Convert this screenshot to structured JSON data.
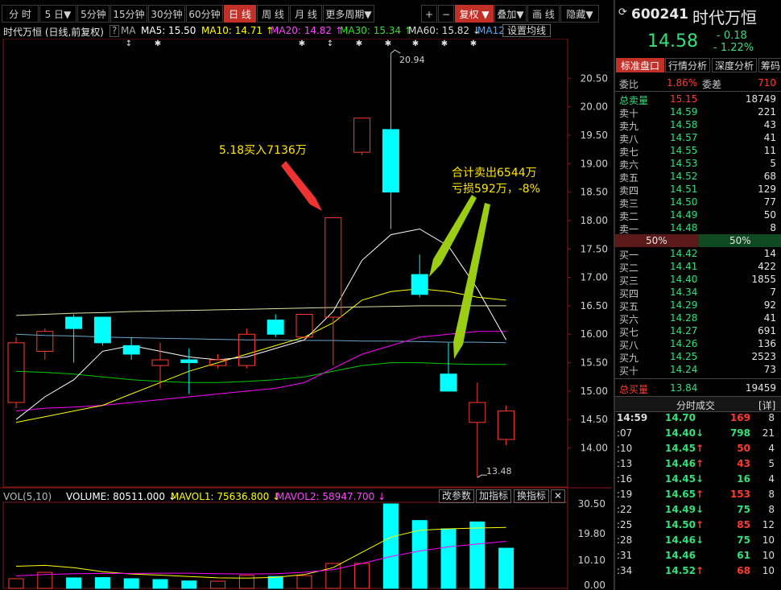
{
  "toolbar": {
    "periods": [
      "分 时",
      "5 日▼",
      "5分钟",
      "15分钟",
      "30分钟",
      "60分钟",
      "日 线",
      "周 线",
      "月 线",
      "更多周期▼"
    ],
    "active_period": "日 线",
    "controls": [
      "+",
      "−",
      "复权 ▼",
      "叠加▼",
      "画 线",
      "隐藏▼"
    ],
    "active_control": "复权 ▼"
  },
  "chart_header": {
    "name": "时代万恒 (日线,前复权)",
    "help": "?",
    "ma_label": "MA",
    "ma5": "MA5: 15.50",
    "ma10": "MA10: 14.71 ↑",
    "ma20": "MA20: 14.82 ↑",
    "ma30": "MA30: 15.34 ↑",
    "ma60": "MA60: 15.82 ↓",
    "ma120": "MA12",
    "settings": "设置均线"
  },
  "annotations": {
    "buy": "5.18买入7136万",
    "sell_line1": "合计卖出6544万",
    "sell_line2": "亏损592万，-8%",
    "high_label": "20.94",
    "low_label": "13.48"
  },
  "volume_header": {
    "vol": "VOL(5,10)",
    "volume": "VOLUME: 80511.000 ↓",
    "mavol1": "MAVOL1: 75636.800 ↓",
    "mavol2": "MAVOL2: 58947.700 ↓",
    "btn1": "改参数",
    "btn2": "加指标",
    "btn3": "换指标",
    "close": "✕"
  },
  "colors": {
    "up": "#ff3b30",
    "down": "#00ffff",
    "ma5": "#ffffff",
    "ma10": "#ffff00",
    "ma20": "#ff00ff",
    "ma30": "#00cc00",
    "ma60": "#e0e0a0",
    "accent": "#c23127"
  },
  "chart_data": {
    "type": "candlestick",
    "price_axis": {
      "ticks": [
        20.5,
        20.0,
        19.5,
        19.0,
        18.5,
        18.0,
        17.5,
        17.0,
        16.5,
        16.0,
        15.5,
        15.0,
        14.5,
        14.0
      ],
      "range": [
        13.3,
        21.0
      ]
    },
    "candles": [
      {
        "o": 14.8,
        "h": 15.95,
        "l": 14.7,
        "c": 15.85,
        "dir": "up"
      },
      {
        "o": 15.7,
        "h": 16.1,
        "l": 15.55,
        "c": 16.05,
        "dir": "up"
      },
      {
        "o": 16.3,
        "h": 16.35,
        "l": 15.5,
        "c": 16.1,
        "dir": "down"
      },
      {
        "o": 16.3,
        "h": 16.25,
        "l": 15.8,
        "c": 15.85,
        "dir": "down"
      },
      {
        "o": 15.8,
        "h": 15.95,
        "l": 15.55,
        "c": 15.65,
        "dir": "down"
      },
      {
        "o": 15.55,
        "h": 15.85,
        "l": 15.05,
        "c": 15.45,
        "dir": "up"
      },
      {
        "o": 15.55,
        "h": 15.75,
        "l": 14.95,
        "c": 15.5,
        "dir": "down"
      },
      {
        "o": 15.45,
        "h": 15.65,
        "l": 15.4,
        "c": 15.55,
        "dir": "up"
      },
      {
        "o": 15.45,
        "h": 16.1,
        "l": 15.4,
        "c": 16.0,
        "dir": "up"
      },
      {
        "o": 16.0,
        "h": 16.35,
        "l": 15.95,
        "c": 16.25,
        "dir": "down"
      },
      {
        "o": 15.95,
        "h": 16.35,
        "l": 15.9,
        "c": 16.35,
        "dir": "up"
      },
      {
        "o": 16.3,
        "h": 18.05,
        "l": 15.45,
        "c": 18.05,
        "dir": "up"
      },
      {
        "o": 19.2,
        "h": 19.8,
        "l": 19.15,
        "c": 19.8,
        "dir": "up"
      },
      {
        "o": 19.6,
        "h": 20.94,
        "l": 17.85,
        "c": 18.5,
        "dir": "down"
      },
      {
        "o": 17.05,
        "h": 17.4,
        "l": 16.65,
        "c": 16.7,
        "dir": "down"
      },
      {
        "o": 15.3,
        "h": 15.85,
        "l": 15.0,
        "c": 15.0,
        "dir": "down"
      },
      {
        "o": 14.45,
        "h": 15.15,
        "l": 13.48,
        "c": 14.8,
        "dir": "up"
      },
      {
        "o": 14.15,
        "h": 14.75,
        "l": 14.05,
        "c": 14.65,
        "dir": "up"
      }
    ],
    "volume_axis": {
      "ticks": [
        30.5,
        19.8,
        10.1,
        0.0
      ],
      "range": [
        0,
        30.5
      ]
    },
    "volumes": [
      {
        "v": 3.5,
        "dir": "up"
      },
      {
        "v": 5.8,
        "dir": "up"
      },
      {
        "v": 3.8,
        "dir": "down"
      },
      {
        "v": 3.9,
        "dir": "down"
      },
      {
        "v": 3.5,
        "dir": "down"
      },
      {
        "v": 3.2,
        "dir": "down"
      },
      {
        "v": 2.7,
        "dir": "down"
      },
      {
        "v": 2.6,
        "dir": "up"
      },
      {
        "v": 4.7,
        "dir": "up"
      },
      {
        "v": 4.3,
        "dir": "down"
      },
      {
        "v": 4.6,
        "dir": "up"
      },
      {
        "v": 9.0,
        "dir": "up"
      },
      {
        "v": 9.0,
        "dir": "up"
      },
      {
        "v": 30.5,
        "dir": "down"
      },
      {
        "v": 24.5,
        "dir": "down"
      },
      {
        "v": 21.5,
        "dir": "down"
      },
      {
        "v": 24.0,
        "dir": "down"
      },
      {
        "v": 14.5,
        "dir": "down"
      }
    ],
    "ma5": [
      14.5,
      14.9,
      15.2,
      15.7,
      15.8,
      15.7,
      15.6,
      15.55,
      15.6,
      15.75,
      15.9,
      16.4,
      17.3,
      17.75,
      17.85,
      17.55,
      16.8,
      15.9
    ],
    "ma10": [
      14.45,
      14.55,
      14.65,
      14.75,
      14.95,
      15.15,
      15.35,
      15.5,
      15.65,
      15.8,
      15.95,
      16.2,
      16.6,
      16.75,
      16.8,
      16.75,
      16.65,
      16.6
    ],
    "ma20": [
      14.65,
      14.7,
      14.72,
      14.75,
      14.8,
      14.85,
      14.9,
      14.95,
      15.0,
      15.05,
      15.15,
      15.4,
      15.65,
      15.8,
      15.95,
      16.0,
      16.05,
      16.05
    ],
    "ma30": [
      15.35,
      15.33,
      15.3,
      15.25,
      15.2,
      15.17,
      15.15,
      15.15,
      15.17,
      15.2,
      15.25,
      15.35,
      15.45,
      15.5,
      15.5,
      15.48,
      15.47,
      15.47
    ],
    "ma60": [
      16.33,
      16.35,
      16.37,
      16.38,
      16.4,
      16.41,
      16.42,
      16.43,
      16.44,
      16.45,
      16.46,
      16.47,
      16.48,
      16.49,
      16.5,
      16.5,
      16.5,
      16.5
    ],
    "maflat": [
      16.0,
      15.98,
      15.97,
      15.95,
      15.94,
      15.93,
      15.92,
      15.91,
      15.9,
      15.9,
      15.89,
      15.89,
      15.88,
      15.88,
      15.87,
      15.86,
      15.86,
      15.85
    ],
    "mavol1": [
      8.0,
      8.3,
      7.5,
      6.0,
      5.2,
      4.8,
      4.3,
      3.8,
      3.7,
      4.0,
      5.0,
      7.5,
      13.0,
      18.5,
      21.0,
      21.5,
      21.8,
      22.0
    ],
    "mavol2": [
      4.5,
      5.0,
      5.3,
      5.4,
      5.4,
      5.5,
      5.5,
      5.3,
      5.2,
      5.3,
      5.8,
      6.8,
      9.0,
      11.5,
      13.5,
      15.0,
      16.0,
      17.0
    ]
  },
  "quote": {
    "code": "600241",
    "name": "时代万恒",
    "price": "14.58",
    "change": "- 0.18",
    "change_pct": "- 1.22%",
    "tabs": [
      "标准盘口",
      "行情分析",
      "深度分析",
      "筹码"
    ],
    "webi_label": "委比",
    "webi_value": "1.86%",
    "weicha_label": "委差",
    "weicha_value": "710",
    "total_sell_label": "总卖量",
    "total_sell_price": "15.15",
    "total_sell_vol": "18749",
    "sells": [
      {
        "label": "卖十",
        "price": "14.59",
        "vol": "221"
      },
      {
        "label": "卖九",
        "price": "14.58",
        "vol": "43"
      },
      {
        "label": "卖八",
        "price": "14.57",
        "vol": "41"
      },
      {
        "label": "卖七",
        "price": "14.55",
        "vol": "11"
      },
      {
        "label": "卖六",
        "price": "14.53",
        "vol": "5"
      },
      {
        "label": "卖五",
        "price": "14.52",
        "vol": "68"
      },
      {
        "label": "卖四",
        "price": "14.51",
        "vol": "129"
      },
      {
        "label": "卖三",
        "price": "14.50",
        "vol": "77"
      },
      {
        "label": "卖二",
        "price": "14.49",
        "vol": "50"
      },
      {
        "label": "卖一",
        "price": "14.48",
        "vol": "8"
      }
    ],
    "ratio_left": "50%",
    "ratio_right": "50%",
    "ratio_left_share": 0.5,
    "buys": [
      {
        "label": "买一",
        "price": "14.42",
        "vol": "14"
      },
      {
        "label": "买二",
        "price": "14.41",
        "vol": "422"
      },
      {
        "label": "买三",
        "price": "14.40",
        "vol": "1855"
      },
      {
        "label": "买四",
        "price": "14.34",
        "vol": "7"
      },
      {
        "label": "买五",
        "price": "14.29",
        "vol": "92"
      },
      {
        "label": "买六",
        "price": "14.28",
        "vol": "41"
      },
      {
        "label": "买七",
        "price": "14.27",
        "vol": "691"
      },
      {
        "label": "买八",
        "price": "14.26",
        "vol": "136"
      },
      {
        "label": "买九",
        "price": "14.25",
        "vol": "2523"
      },
      {
        "label": "买十",
        "price": "14.24",
        "vol": "73"
      }
    ],
    "total_buy_label": "总买量",
    "total_buy_price": "13.84",
    "total_buy_vol": "19459",
    "ticks_title": "分时成交",
    "ticks_detail": "[详]",
    "ticks": [
      {
        "t": "14:59",
        "p": "14.70",
        "a": "",
        "v": "169",
        "n": "8",
        "c": "up"
      },
      {
        "t": ":07",
        "p": "14.40",
        "a": "↓",
        "v": "798",
        "n": "21",
        "c": "down"
      },
      {
        "t": ":10",
        "p": "14.45",
        "a": "↑",
        "v": "50",
        "n": "4",
        "c": "up"
      },
      {
        "t": ":13",
        "p": "14.46",
        "a": "↑",
        "v": "43",
        "n": "5",
        "c": "up"
      },
      {
        "t": ":16",
        "p": "14.45",
        "a": "↓",
        "v": "16",
        "n": "4",
        "c": "down"
      },
      {
        "t": ":19",
        "p": "14.65",
        "a": "↑",
        "v": "153",
        "n": "8",
        "c": "up"
      },
      {
        "t": ":22",
        "p": "14.49",
        "a": "↓",
        "v": "75",
        "n": "8",
        "c": "down"
      },
      {
        "t": ":25",
        "p": "14.50",
        "a": "↑",
        "v": "85",
        "n": "12",
        "c": "up"
      },
      {
        "t": ":28",
        "p": "14.46",
        "a": "↓",
        "v": "75",
        "n": "10",
        "c": "down"
      },
      {
        "t": ":31",
        "p": "14.46",
        "a": "",
        "v": "61",
        "n": "10",
        "c": "down"
      },
      {
        "t": ":34",
        "p": "14.52",
        "a": "↑",
        "v": "68",
        "n": "10",
        "c": "up"
      }
    ]
  }
}
